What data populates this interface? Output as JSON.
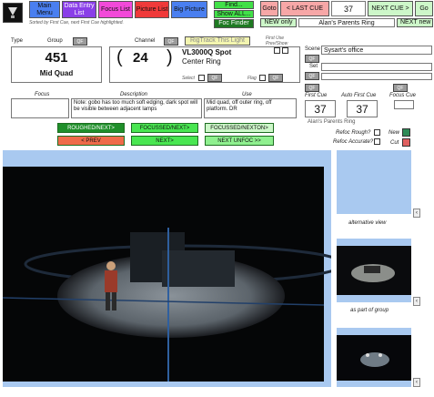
{
  "nav": {
    "main_menu": "Main Menu",
    "data_entry": "Data Entry List",
    "focus_list": "Focus List",
    "picture_list": "Picture List",
    "big_picture": "Big Picture",
    "find": "Find...",
    "show_all": "Show ALL...",
    "foc_finder": "Foc Finder",
    "sort_note": "Sorted by First Cue, next First Cue highlighted."
  },
  "cue_nav": {
    "goto": "Goto",
    "last_cue": "< LAST CUE",
    "current_cue": "37",
    "next_cue": "NEXT CUE >",
    "go": "Go",
    "new_only": "NEW only",
    "cue_name": "Alan's Parents Ring",
    "next_new": "NEXT new"
  },
  "record": {
    "type_label": "Type",
    "group_label": "Group",
    "qf": "QF",
    "type_value": "451",
    "group_value": "Mid Quad",
    "channel_label": "Channel",
    "channel_value": "24",
    "open_paren": "(",
    "close_paren": ")",
    "rig_track": "RigTrack This Light",
    "fixture": "VL3000Q Spot",
    "position": "Center Ring",
    "first_use": "First Use",
    "prev_show": "Prev/Show",
    "select_label": "Select",
    "flag_label": "Flag",
    "scene_label": "Scene",
    "scene_value": "Sysart's office",
    "set_label": "Set"
  },
  "notes": {
    "focus_label": "Focus",
    "description_label": "Description",
    "use_label": "Use",
    "description": "Note: gobo has too much soft edging, dark spot will be visible between adjacent lamps",
    "use": "Mid quad, off outer ring, off platform. DR",
    "first_cue_label": "First Cue",
    "auto_first_cue_label": "Auto First Cue",
    "focus_cue_label": "Focus Cue",
    "first_cue": "37",
    "auto_first_cue": "37",
    "cue_caption": "Alan's Parents Ring"
  },
  "actions": {
    "roughed_next": "ROUGHED/NEXT>",
    "focussed_next": "FOCUSSED/NEXT>",
    "focussed_nexton": "FOCUSSED/NEXTON>",
    "prev": "< PREV",
    "next": "NEXT>",
    "next_unfoc": "NEXT UNFOC >>",
    "refoc_rough": "Refoc Rough?",
    "refoc_accurate": "Refoc Accurate?",
    "new_label": "New",
    "cut_label": "Cut"
  },
  "side": {
    "alt_view": "alternative view",
    "group_view": "as part of group"
  },
  "colors": {
    "main_menu": "#4a7ff0",
    "data_entry": "#8a3fe8",
    "focus_list": "#f24ad9",
    "picture_list": "#f03a3a",
    "big_picture": "#4a7ff0",
    "find": "#41e048",
    "cue_nav": "#f7a7a7"
  }
}
